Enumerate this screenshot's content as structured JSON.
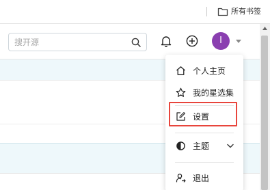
{
  "bookmarks": {
    "all_bookmarks_label": "所有书签"
  },
  "header": {
    "search_placeholder": "搜开源",
    "avatar_initial": "I"
  },
  "menu": {
    "items": [
      {
        "label": "个人主页",
        "icon": "home-icon"
      },
      {
        "label": "我的星选集",
        "icon": "star-icon"
      },
      {
        "label": "设置",
        "icon": "edit-icon"
      },
      {
        "label": "主题",
        "icon": "theme-icon"
      },
      {
        "label": "退出",
        "icon": "logout-icon"
      }
    ]
  },
  "colors": {
    "avatar_bg": "#8a3fb0",
    "highlight": "#e8453c",
    "row_highlight": "#eef8fb"
  }
}
